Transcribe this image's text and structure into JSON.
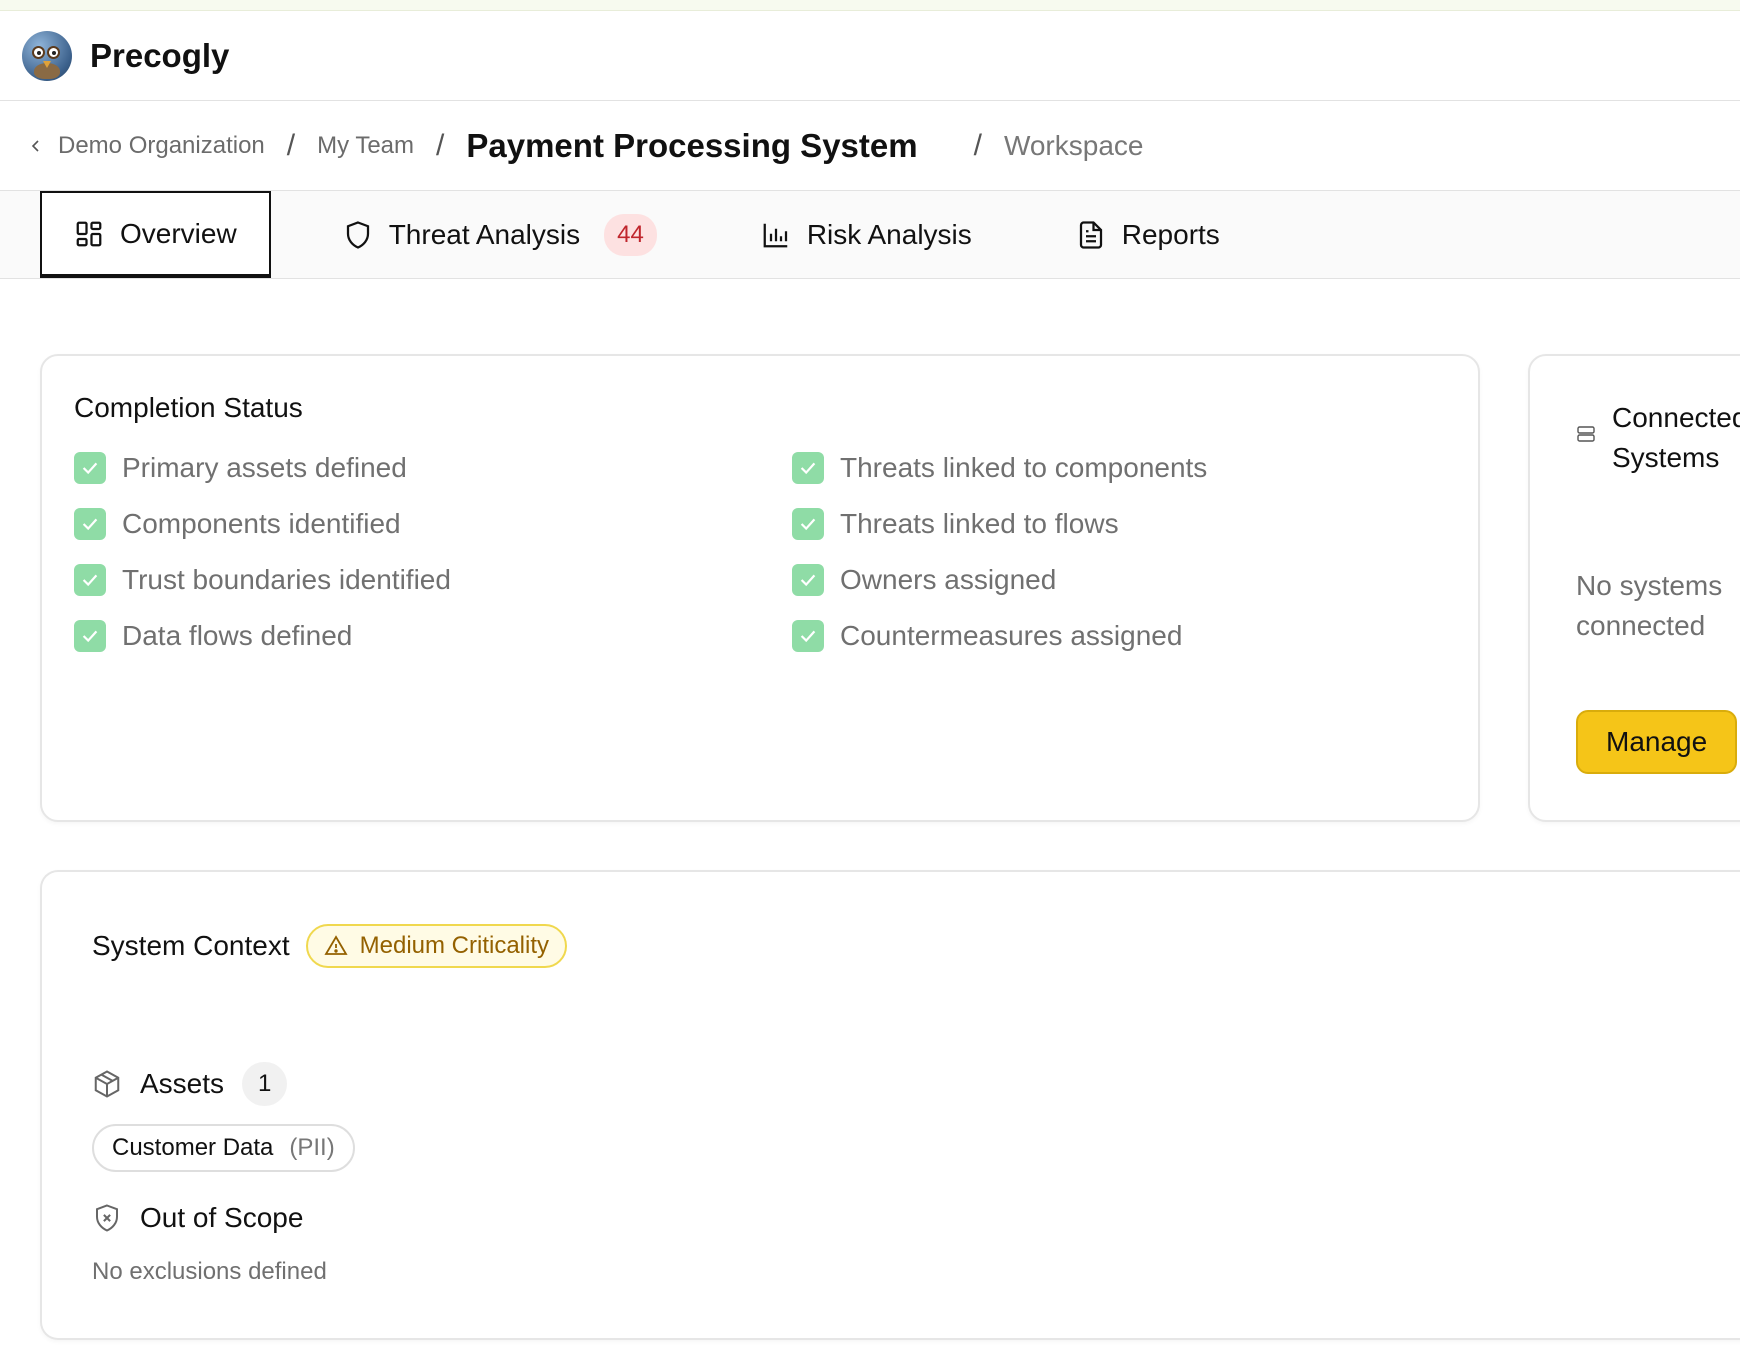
{
  "app": {
    "name": "Precogly"
  },
  "breadcrumb": {
    "org": "Demo Organization",
    "team": "My Team",
    "system": "Payment Processing System",
    "workspace": "Workspace",
    "separator": "/"
  },
  "tabs": [
    {
      "label": "Overview",
      "icon": "grid-icon",
      "active": true
    },
    {
      "label": "Threat Analysis",
      "icon": "shield-icon",
      "badge": "44"
    },
    {
      "label": "Risk Analysis",
      "icon": "bar-chart-icon"
    },
    {
      "label": "Reports",
      "icon": "document-icon"
    }
  ],
  "completion": {
    "title": "Completion Status",
    "left": [
      "Primary assets defined",
      "Components identified",
      "Trust boundaries identified",
      "Data flows defined"
    ],
    "right": [
      "Threats linked to components",
      "Threats linked to flows",
      "Owners assigned",
      "Countermeasures assigned"
    ]
  },
  "connected": {
    "title_line1": "Connected",
    "title_line2": "Systems",
    "empty_line1": "No systems",
    "empty_line2": "connected",
    "manage_label": "Manage"
  },
  "context": {
    "title": "System Context",
    "criticality": "Medium Criticality",
    "assets_title": "Assets",
    "assets_count": "1",
    "asset_name": "Customer Data",
    "asset_tag": "(PII)",
    "scope_title": "Out of Scope",
    "scope_empty": "No exclusions defined"
  },
  "colors": {
    "accent": "#f5c518",
    "check": "#8fdca6",
    "badge_bg": "#fde1e1",
    "badge_text": "#c0262d",
    "criticality_text": "#946100"
  }
}
